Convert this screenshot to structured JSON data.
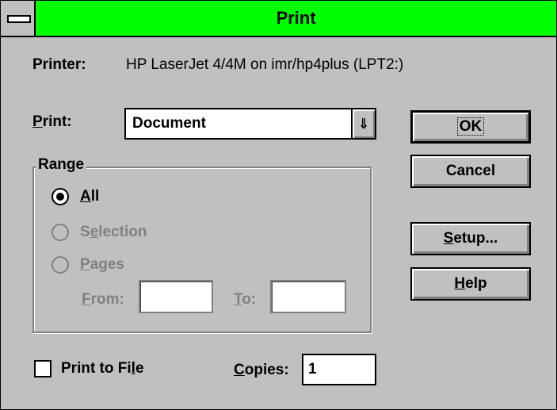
{
  "window": {
    "title": "Print"
  },
  "printer": {
    "label": "Printer:",
    "value": "HP LaserJet 4/4M on imr/hp4plus (LPT2:)"
  },
  "print_select": {
    "label_prefix": "",
    "label_mnemonic": "P",
    "label_rest": "rint:",
    "value": "Document",
    "arrow_glyph": "⇓"
  },
  "range": {
    "title": "Range",
    "options": [
      {
        "mnemonic": "A",
        "rest": "ll",
        "pre": "",
        "selected": true,
        "enabled": true
      },
      {
        "pre": "S",
        "mnemonic": "e",
        "rest": "lection",
        "selected": false,
        "enabled": false
      },
      {
        "pre": "",
        "mnemonic": "P",
        "rest": "ages",
        "selected": false,
        "enabled": false
      }
    ],
    "from": {
      "mnemonic": "F",
      "rest": "rom:",
      "value": ""
    },
    "to": {
      "mnemonic": "T",
      "rest": "o:",
      "value": ""
    }
  },
  "buttons": {
    "ok": {
      "pre": "",
      "mnemonic": "",
      "rest": "OK",
      "label": "OK"
    },
    "cancel": {
      "label": "Cancel"
    },
    "setup": {
      "mnemonic": "S",
      "rest": "etup..."
    },
    "help": {
      "mnemonic": "H",
      "rest": "elp"
    }
  },
  "print_to_file": {
    "pre": "Print to Fi",
    "mnemonic": "l",
    "rest": "e",
    "checked": false
  },
  "copies": {
    "mnemonic": "C",
    "rest": "opies:",
    "value": "1"
  },
  "colors": {
    "title_bar": "#00ff00",
    "face": "#c0c0c0",
    "disabled_text": "#808080"
  }
}
